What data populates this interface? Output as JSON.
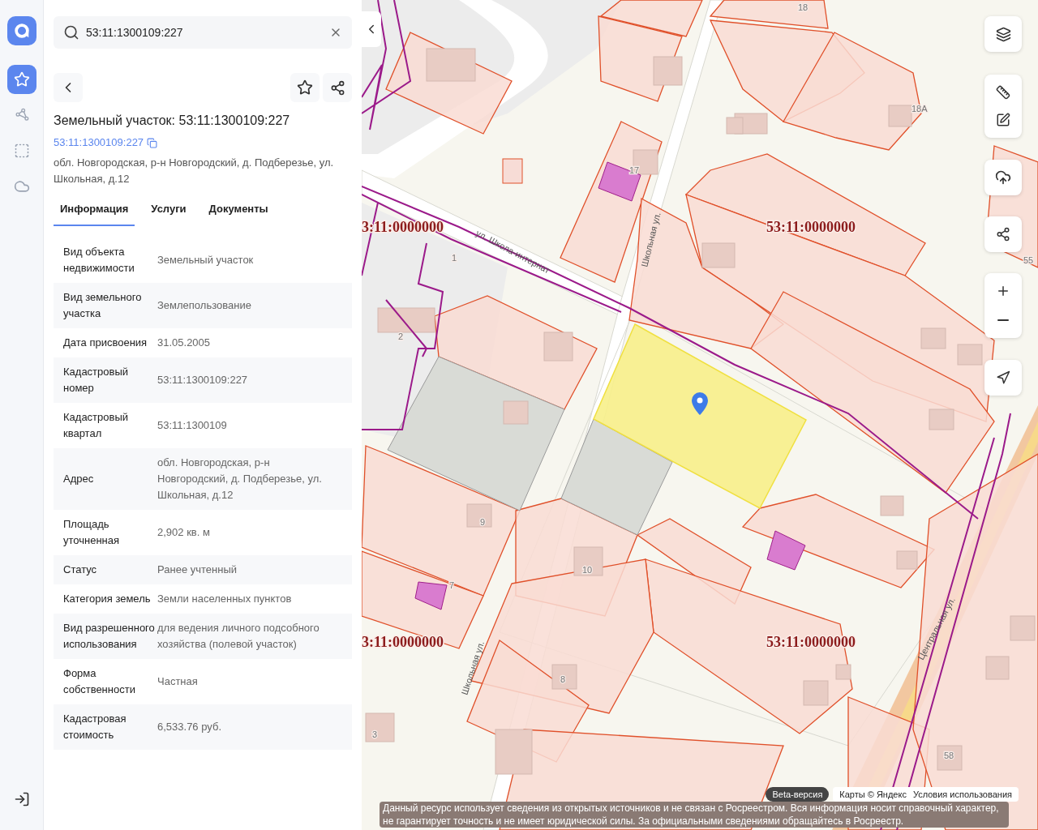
{
  "rail": [
    {
      "kind": "star",
      "selected": true
    },
    {
      "kind": "polygon",
      "selected": false
    },
    {
      "kind": "select",
      "selected": false
    },
    {
      "kind": "cloud",
      "selected": false
    }
  ],
  "search": {
    "value": "53:11:1300109:227"
  },
  "object": {
    "title": "Земельный участок: 53:11:1300109:227",
    "number_link": "53:11:1300109:227",
    "address": "обл. Новгородская, р-н Новгородский, д. Подберезье, ул. Школьная, д.12"
  },
  "tabs": [
    {
      "label": "Информация",
      "selected": true
    },
    {
      "label": "Услуги",
      "selected": false
    },
    {
      "label": "Документы",
      "selected": false
    }
  ],
  "properties": [
    {
      "label": "Вид объекта недвижимости",
      "value": "Земельный участок"
    },
    {
      "label": "Вид земельного участка",
      "value": "Землепользование"
    },
    {
      "label": "Дата присвоения",
      "value": "31.05.2005"
    },
    {
      "label": "Кадастровый номер",
      "value": "53:11:1300109:227"
    },
    {
      "label": "Кадастровый квартал",
      "value": "53:11:1300109"
    },
    {
      "label": "Адрес",
      "value": "обл. Новгородская, р-н Новгородский, д. Подберезье, ул. Школьная, д.12"
    },
    {
      "label": "Площадь уточненная",
      "value": "2,902 кв. м"
    },
    {
      "label": "Статус",
      "value": "Ранее учтенный"
    },
    {
      "label": "Категория земель",
      "value": "Земли населенных пунктов"
    },
    {
      "label": "Вид разрешенного использования",
      "value": "для ведения личного подсобного хозяйства (полевой участок)"
    },
    {
      "label": "Форма собственности",
      "value": "Частная"
    },
    {
      "label": "Кадастровая стоимость",
      "value": "6,533.76 руб."
    }
  ],
  "map": {
    "labels": [
      {
        "kind": "quarter",
        "text": "3:11:0000000"
      },
      {
        "kind": "quarter",
        "text": "53:11:0000000"
      },
      {
        "kind": "quarter",
        "text": "3:11:0000000"
      },
      {
        "kind": "quarter",
        "text": "53:11:0000000"
      },
      {
        "kind": "street",
        "text": "ул. Школа-интернат"
      },
      {
        "kind": "street",
        "text": "Школьная ул."
      },
      {
        "kind": "street",
        "text": "Школьная ул."
      },
      {
        "kind": "street",
        "text": "Центральная ул."
      },
      {
        "kind": "house",
        "text": "18"
      },
      {
        "kind": "house",
        "text": "18А"
      },
      {
        "kind": "house",
        "text": "17"
      },
      {
        "kind": "house",
        "text": "1"
      },
      {
        "kind": "house",
        "text": "2"
      },
      {
        "kind": "house",
        "text": "9"
      },
      {
        "kind": "house",
        "text": "7"
      },
      {
        "kind": "house",
        "text": "10"
      },
      {
        "kind": "house",
        "text": "8"
      },
      {
        "kind": "house",
        "text": "3"
      },
      {
        "kind": "house",
        "text": "58"
      },
      {
        "kind": "house",
        "text": "55"
      }
    ],
    "beta": "Beta-версия",
    "provider": "Карты © Яндекс",
    "terms": "Условия использования",
    "disclaimer": "Данный ресурс использует сведения из открытых источников и не связан с Росреестром. Вся информация носит справочный характер, не гарантирует точность и не имеет юридической силы. За официальными сведениями обращайтесь в Росреестр."
  }
}
